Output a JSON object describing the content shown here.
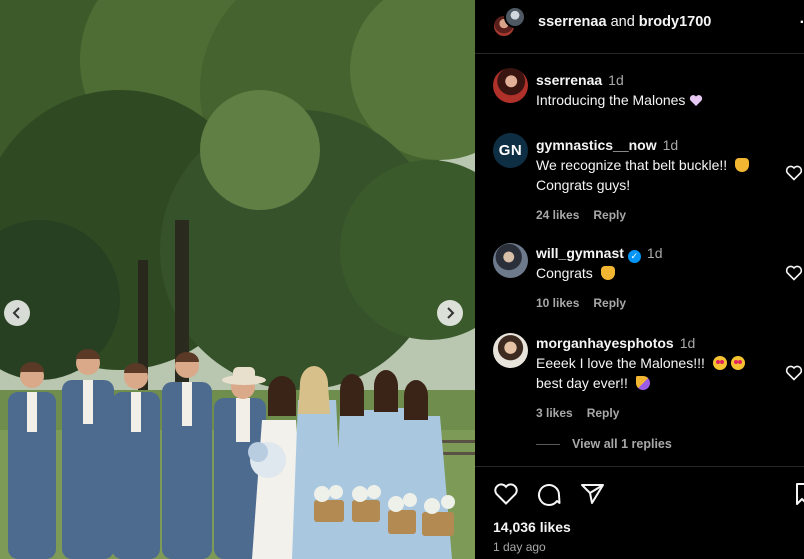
{
  "header": {
    "user1": "sserrenaa",
    "joiner": "and",
    "user2": "brody1700",
    "more_icon": "more-dots-icon"
  },
  "caption": {
    "username": "sserrenaa",
    "time": "1d",
    "text": "Introducing the Malones"
  },
  "comments": [
    {
      "username": "gymnastics__now",
      "avatar_text": "GN",
      "time": "1d",
      "line1": "We recognize that belt buckle!!",
      "line2": "Congrats guys!",
      "likes": "24 likes",
      "reply": "Reply"
    },
    {
      "username": "will_gymnast",
      "verified": true,
      "time": "1d",
      "line1": "Congrats",
      "reply": "Reply",
      "likes": "10 likes"
    },
    {
      "username": "morganhayesphotos",
      "time": "1d",
      "line1": "Eeeek I love the Malones!!!",
      "line2": "best day ever!!",
      "likes": "3 likes",
      "reply": "Reply"
    }
  ],
  "view_replies": "View all 1 replies",
  "footer": {
    "likes": "14,036 likes",
    "date": "1 day ago"
  },
  "colors": {
    "background": "#000000",
    "text": "#f5f5f5",
    "secondary_text": "#a8a8a8",
    "verified": "#0095f6",
    "dress": "#a9c7de",
    "suit": "#4d6a8f"
  }
}
